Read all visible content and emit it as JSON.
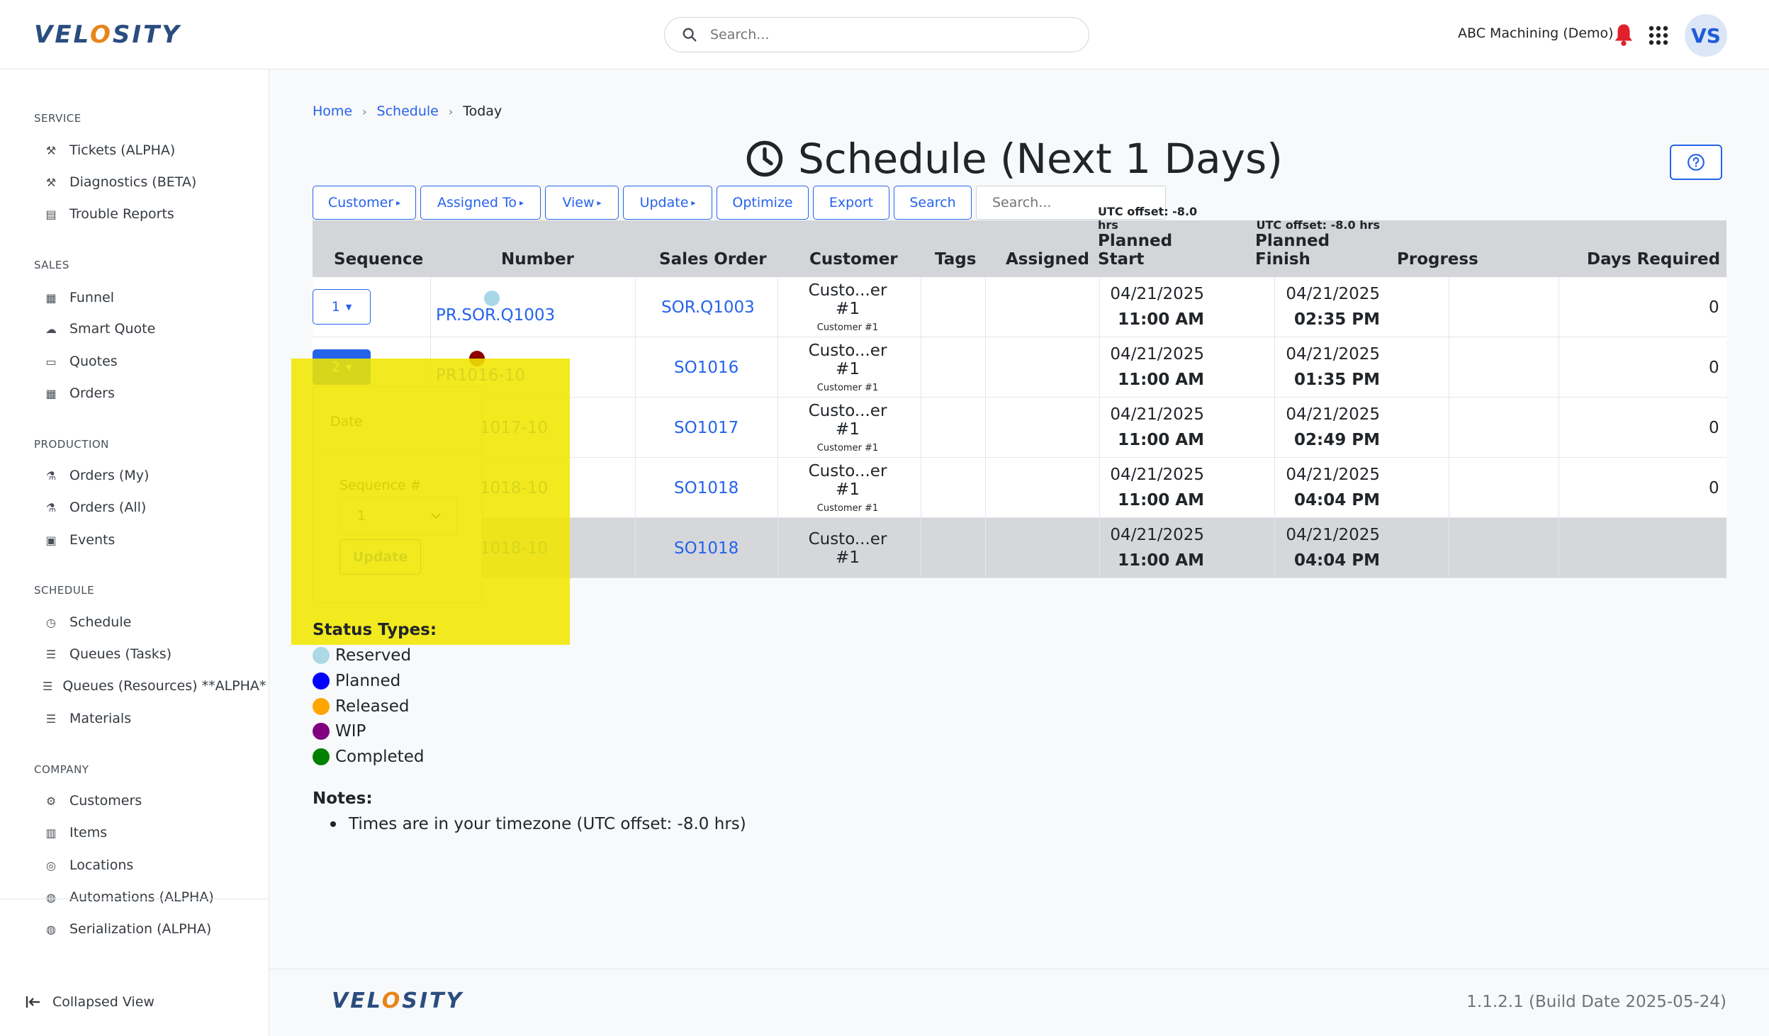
{
  "header": {
    "logo": "VELOSITY",
    "search_placeholder": "Search...",
    "company": "ABC Machining (Demo)",
    "avatar_initials": "VS"
  },
  "sidebar": {
    "sections": [
      {
        "title": "SERVICE",
        "items": [
          {
            "label": "Tickets (ALPHA)",
            "icon": "wrench-icon"
          },
          {
            "label": "Diagnostics (BETA)",
            "icon": "wrench-icon"
          },
          {
            "label": "Trouble Reports",
            "icon": "archive-icon"
          }
        ]
      },
      {
        "title": "SALES",
        "items": [
          {
            "label": "Funnel",
            "icon": "building-icon"
          },
          {
            "label": "Smart Quote",
            "icon": "cloud-icon"
          },
          {
            "label": "Quotes",
            "icon": "money-icon"
          },
          {
            "label": "Orders",
            "icon": "table-icon"
          }
        ]
      },
      {
        "title": "PRODUCTION",
        "items": [
          {
            "label": "Orders (My)",
            "icon": "crane-icon"
          },
          {
            "label": "Orders (All)",
            "icon": "crane-icon"
          },
          {
            "label": "Events",
            "icon": "calendar-icon"
          }
        ]
      },
      {
        "title": "SCHEDULE",
        "items": [
          {
            "label": "Schedule",
            "icon": "clock-icon"
          },
          {
            "label": "Queues (Tasks)",
            "icon": "list-icon"
          },
          {
            "label": "Queues (Resources) **ALPHA**",
            "icon": "list-icon"
          },
          {
            "label": "Materials",
            "icon": "list-icon"
          }
        ]
      },
      {
        "title": "COMPANY",
        "items": [
          {
            "label": "Customers",
            "icon": "gear-icon"
          },
          {
            "label": "Items",
            "icon": "warehouse-icon"
          },
          {
            "label": "Locations",
            "icon": "pin-icon"
          },
          {
            "label": "Automations (ALPHA)",
            "icon": "globe-icon"
          },
          {
            "label": "Serialization (ALPHA)",
            "icon": "globe-icon"
          }
        ]
      }
    ],
    "collapse_label": "Collapsed View"
  },
  "breadcrumb": {
    "home": "Home",
    "schedule": "Schedule",
    "current": "Today"
  },
  "page_title": "Schedule (Next 1 Days)",
  "toolbar": {
    "customer": "Customer",
    "assigned_to": "Assigned To",
    "view": "View",
    "update": "Update",
    "optimize": "Optimize",
    "export": "Export",
    "search": "Search",
    "search_placeholder": "Search..."
  },
  "table": {
    "headers": {
      "sequence": "Sequence",
      "number": "Number",
      "sales_order": "Sales Order",
      "customer": "Customer",
      "tags": "Tags",
      "assigned": "Assigned",
      "utc_note": "UTC offset: -8.0 hrs",
      "planned_start": "Planned Start",
      "planned_finish": "Planned Finish",
      "progress": "Progress",
      "days_required": "Days Required"
    },
    "rows": [
      {
        "seq": "1",
        "number": "PR.SOR.Q1003",
        "status_color": "#a8d8e8",
        "sales_order": "SOR.Q1003",
        "customer": "Custo...er #1",
        "customer_sub": "Customer #1",
        "start_date": "04/21/2025",
        "start_time": "11:00 AM",
        "finish_date": "04/21/2025",
        "finish_time": "02:35 PM",
        "days": "0"
      },
      {
        "seq": "2",
        "number": "PR1016-10",
        "status_color": "#8b0000",
        "sales_order": "SO1016",
        "customer": "Custo...er #1",
        "customer_sub": "Customer #1",
        "start_date": "04/21/2025",
        "start_time": "11:00 AM",
        "finish_date": "04/21/2025",
        "finish_time": "01:35 PM",
        "days": "0"
      },
      {
        "seq": "",
        "number": "1017-10",
        "status_color": "",
        "sales_order": "SO1017",
        "customer": "Custo...er #1",
        "customer_sub": "Customer #1",
        "start_date": "04/21/2025",
        "start_time": "11:00 AM",
        "finish_date": "04/21/2025",
        "finish_time": "02:49 PM",
        "days": "0"
      },
      {
        "seq": "",
        "number": "1018-10",
        "status_color": "",
        "sales_order": "SO1018",
        "customer": "Custo...er #1",
        "customer_sub": "Customer #1",
        "start_date": "04/21/2025",
        "start_time": "11:00 AM",
        "finish_date": "04/21/2025",
        "finish_time": "04:04 PM",
        "days": "0"
      },
      {
        "seq": "",
        "number": "1018-10",
        "status_color": "",
        "sales_order": "SO1018",
        "customer": "Custo...er #1",
        "customer_sub": "",
        "start_date": "04/21/2025",
        "start_time": "11:00 AM",
        "finish_date": "04/21/2025",
        "finish_time": "04:04 PM",
        "days": ""
      }
    ]
  },
  "popup": {
    "date_label": "Date",
    "sequence_label": "Sequence #",
    "sequence_value": "1",
    "update_label": "Update"
  },
  "legend": {
    "title": "Status Types:",
    "items": [
      {
        "label": "Reserved",
        "color": "#add8e6"
      },
      {
        "label": "Planned",
        "color": "#0000ff"
      },
      {
        "label": "Released",
        "color": "#ffa500"
      },
      {
        "label": "WIP",
        "color": "#800080"
      },
      {
        "label": "Completed",
        "color": "#008000"
      }
    ]
  },
  "notes": {
    "title": "Notes:",
    "items": [
      "Times are in your timezone (UTC offset: -8.0 hrs)"
    ]
  },
  "footer": {
    "logo": "VELOSITY",
    "version": "1.1.2.1 (Build Date 2025-05-24)"
  },
  "colors": {
    "accent": "#2563eb",
    "highlight": "#f0e600",
    "bell": "#e0202a"
  }
}
